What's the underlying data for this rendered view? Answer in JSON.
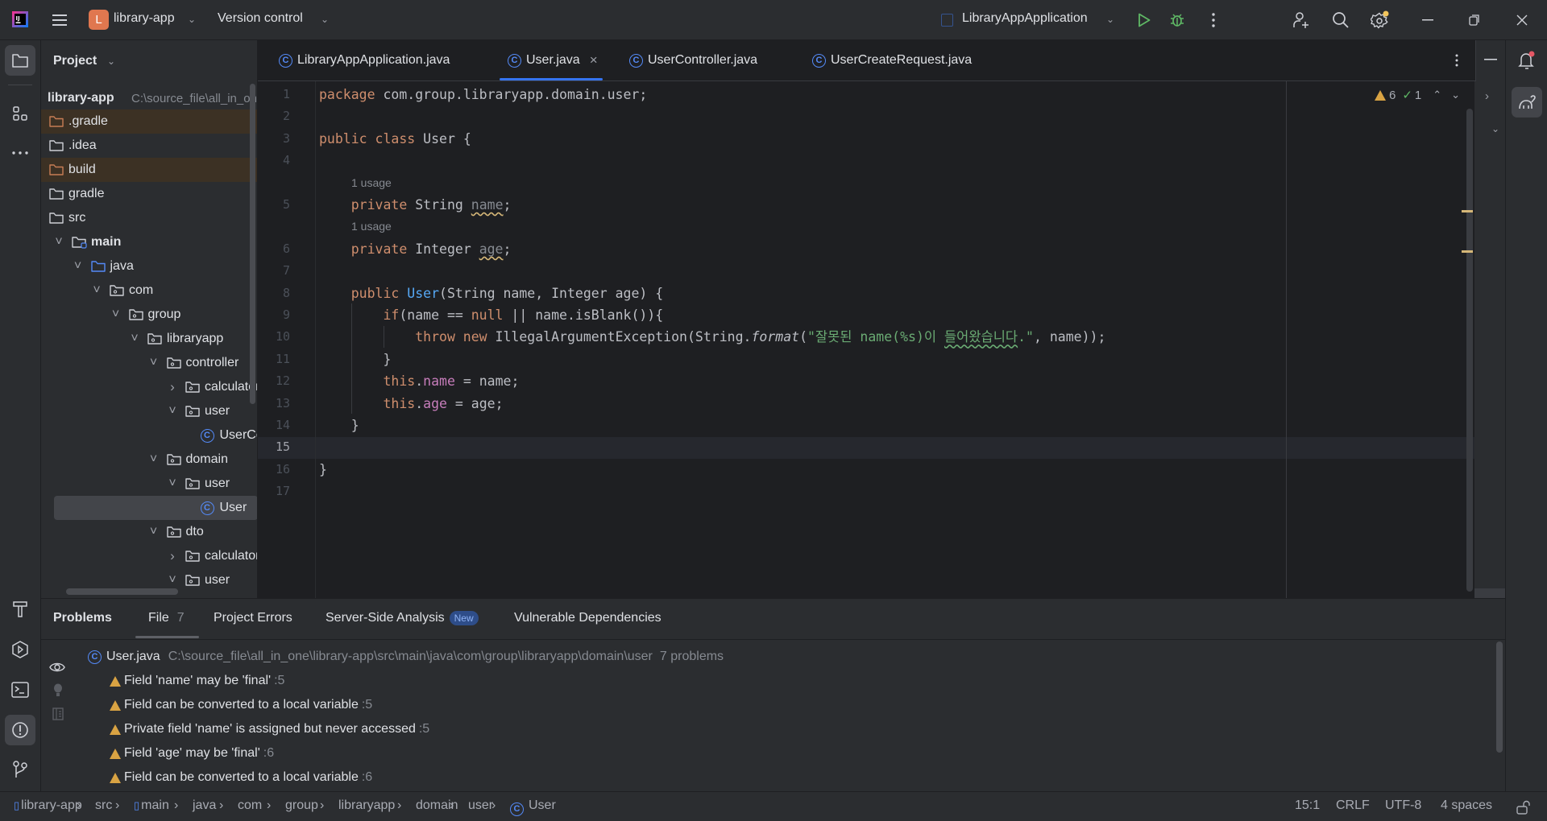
{
  "titlebar": {
    "project_initial": "L",
    "project_name": "library-app",
    "vcs_label": "Version control",
    "run_config": "LibraryAppApplication",
    "colors": {
      "project_badge": "#E0774F",
      "run": "#5FB865",
      "settings_dot": "#F2C55C"
    }
  },
  "left_toolbar": [
    "folder-icon",
    "structure-icon",
    "more-icon",
    "build-icon",
    "run-services-icon",
    "terminal-icon",
    "problems-icon",
    "git-icon"
  ],
  "right_toolbar": [
    "notifications-icon",
    "gradle-icon"
  ],
  "project": {
    "title": "Project",
    "root": {
      "label": "library-app",
      "path": "C:\\source_file\\all_in_one"
    },
    "items": [
      {
        "label": ".gradle",
        "level": 0,
        "icon": "folder",
        "chevron": "",
        "state": "excluded"
      },
      {
        "label": ".idea",
        "level": 0,
        "icon": "folder",
        "chevron": "",
        "state": ""
      },
      {
        "label": "build",
        "level": 0,
        "icon": "folder",
        "chevron": "",
        "state": "excluded"
      },
      {
        "label": "gradle",
        "level": 0,
        "icon": "folder",
        "chevron": "",
        "state": ""
      },
      {
        "label": "src",
        "level": 0,
        "icon": "folder",
        "chevron": "",
        "state": ""
      },
      {
        "label": "main",
        "level": 1,
        "icon": "module-folder",
        "chevron": "down",
        "state": "bold"
      },
      {
        "label": "java",
        "level": 2,
        "icon": "source-folder",
        "chevron": "down",
        "state": ""
      },
      {
        "label": "com",
        "level": 3,
        "icon": "package",
        "chevron": "down",
        "state": ""
      },
      {
        "label": "group",
        "level": 4,
        "icon": "package",
        "chevron": "down",
        "state": ""
      },
      {
        "label": "libraryapp",
        "level": 5,
        "icon": "package",
        "chevron": "down",
        "state": ""
      },
      {
        "label": "controller",
        "level": 6,
        "icon": "package",
        "chevron": "down",
        "state": ""
      },
      {
        "label": "calculator",
        "level": 7,
        "icon": "package",
        "chevron": "right",
        "state": ""
      },
      {
        "label": "user",
        "level": 7,
        "icon": "package",
        "chevron": "down",
        "state": ""
      },
      {
        "label": "UserController",
        "level": 8,
        "icon": "class",
        "chevron": "",
        "state": ""
      },
      {
        "label": "domain",
        "level": 6,
        "icon": "package",
        "chevron": "down",
        "state": ""
      },
      {
        "label": "user",
        "level": 7,
        "icon": "package",
        "chevron": "down",
        "state": ""
      },
      {
        "label": "User",
        "level": 8,
        "icon": "class",
        "chevron": "",
        "state": "selected"
      },
      {
        "label": "dto",
        "level": 6,
        "icon": "package",
        "chevron": "down",
        "state": ""
      },
      {
        "label": "calculator",
        "level": 7,
        "icon": "package",
        "chevron": "right",
        "state": ""
      },
      {
        "label": "user",
        "level": 7,
        "icon": "package",
        "chevron": "down",
        "state": ""
      }
    ]
  },
  "editor_tabs": [
    {
      "label": "LibraryAppApplication.java",
      "active": false
    },
    {
      "label": "User.java",
      "active": true
    },
    {
      "label": "UserController.java",
      "active": false
    },
    {
      "label": "UserCreateRequest.java",
      "active": false
    }
  ],
  "inspections": {
    "warnings": "6",
    "typos": "1"
  },
  "code": {
    "current_line": "15",
    "rows": [
      {
        "num": "1",
        "tokens": [
          [
            "package",
            "kw"
          ],
          [
            " com.group.libraryapp.domain.user;",
            ""
          ]
        ]
      },
      {
        "num": "2",
        "tokens": []
      },
      {
        "num": "3",
        "tokens": [
          [
            "public class",
            "kw"
          ],
          [
            " User {",
            ""
          ]
        ]
      },
      {
        "num": "4",
        "tokens": []
      },
      {
        "inlay": "1 usage"
      },
      {
        "num": "5",
        "tokens": [
          [
            "    private",
            "kw"
          ],
          [
            " String ",
            ""
          ],
          [
            "name",
            "unused"
          ],
          [
            ";",
            ""
          ]
        ]
      },
      {
        "inlay": "1 usage"
      },
      {
        "num": "6",
        "tokens": [
          [
            "    private",
            "kw"
          ],
          [
            " Integer ",
            ""
          ],
          [
            "age",
            "unused"
          ],
          [
            ";",
            ""
          ]
        ]
      },
      {
        "num": "7",
        "tokens": []
      },
      {
        "num": "8",
        "tokens": [
          [
            "    public",
            "kw"
          ],
          [
            " ",
            ""
          ],
          [
            "User",
            "fn"
          ],
          [
            "(String name, Integer age) {",
            ""
          ]
        ]
      },
      {
        "num": "9",
        "tokens": [
          [
            "        if",
            "kw"
          ],
          [
            "(name == ",
            ""
          ],
          [
            "null",
            "kw"
          ],
          [
            " || name.isBlank()){",
            ""
          ]
        ]
      },
      {
        "num": "10",
        "tokens": [
          [
            "            throw new",
            "kw"
          ],
          [
            " IllegalArgumentException(String.",
            ""
          ],
          [
            "format",
            "ital"
          ],
          [
            "(",
            ""
          ],
          [
            "\"잘못된 name(%s)이 ",
            "str"
          ],
          [
            "들어왔습니다",
            "strwarn"
          ],
          [
            ".\"",
            "str"
          ],
          [
            ", name));",
            ""
          ]
        ]
      },
      {
        "num": "11",
        "tokens": [
          [
            "        }",
            ""
          ]
        ]
      },
      {
        "num": "12",
        "tokens": [
          [
            "        this",
            "kw"
          ],
          [
            ".",
            ""
          ],
          [
            "name",
            "field"
          ],
          [
            " = name;",
            ""
          ]
        ]
      },
      {
        "num": "13",
        "tokens": [
          [
            "        this",
            "kw"
          ],
          [
            ".",
            ""
          ],
          [
            "age",
            "field"
          ],
          [
            " = age;",
            ""
          ]
        ]
      },
      {
        "num": "14",
        "tokens": [
          [
            "    }",
            ""
          ]
        ]
      },
      {
        "num": "15",
        "tokens": []
      },
      {
        "num": "16",
        "tokens": [
          [
            "}",
            ""
          ]
        ]
      },
      {
        "num": "17",
        "tokens": []
      }
    ]
  },
  "problems": {
    "tabs": [
      {
        "label": "Problems"
      },
      {
        "label": "File",
        "count": "7",
        "active": true
      },
      {
        "label": "Project Errors"
      },
      {
        "label": "Server-Side Analysis",
        "badge": "New"
      },
      {
        "label": "Vulnerable Dependencies"
      }
    ],
    "file": {
      "name": "User.java",
      "path": "C:\\source_file\\all_in_one\\library-app\\src\\main\\java\\com\\group\\libraryapp\\domain\\user",
      "count": "7 problems"
    },
    "items": [
      {
        "text": "Field 'name' may be 'final'",
        "line": ":5"
      },
      {
        "text": "Field can be converted to a local variable",
        "line": ":5"
      },
      {
        "text": "Private field 'name' is assigned but never accessed",
        "line": ":5"
      },
      {
        "text": "Field 'age' may be 'final'",
        "line": ":6"
      },
      {
        "text": "Field can be converted to a local variable",
        "line": ":6"
      }
    ]
  },
  "status": {
    "breadcrumbs": [
      "library-app",
      "src",
      "main",
      "java",
      "com",
      "group",
      "libraryapp",
      "domain",
      "user",
      "User"
    ],
    "position": "15:1",
    "line_sep": "CRLF",
    "encoding": "UTF-8",
    "indent": "4 spaces"
  }
}
